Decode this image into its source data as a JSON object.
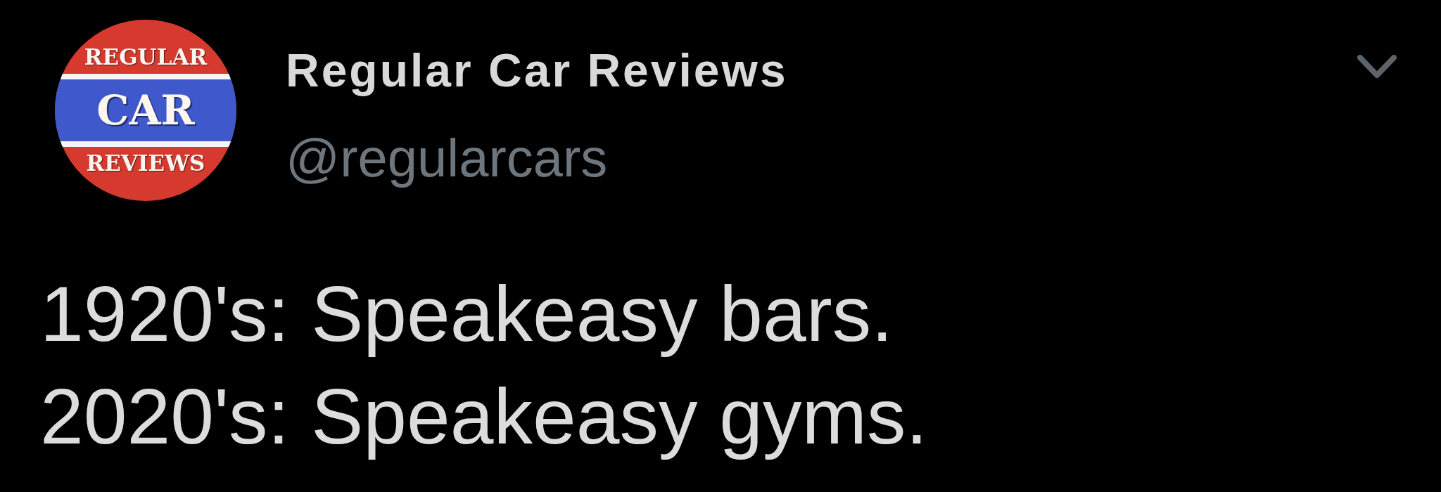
{
  "tweet": {
    "avatar": {
      "top_text": "REGULAR",
      "band_text": "CAR",
      "bottom_text": "REVIEWS"
    },
    "author": {
      "name": "Regular Car Reviews",
      "handle": "@regularcars"
    },
    "menu": {
      "kind": "chevron"
    },
    "text_lines": [
      "1920's: Speakeasy bars.",
      "2020's: Speakeasy gyms."
    ]
  }
}
